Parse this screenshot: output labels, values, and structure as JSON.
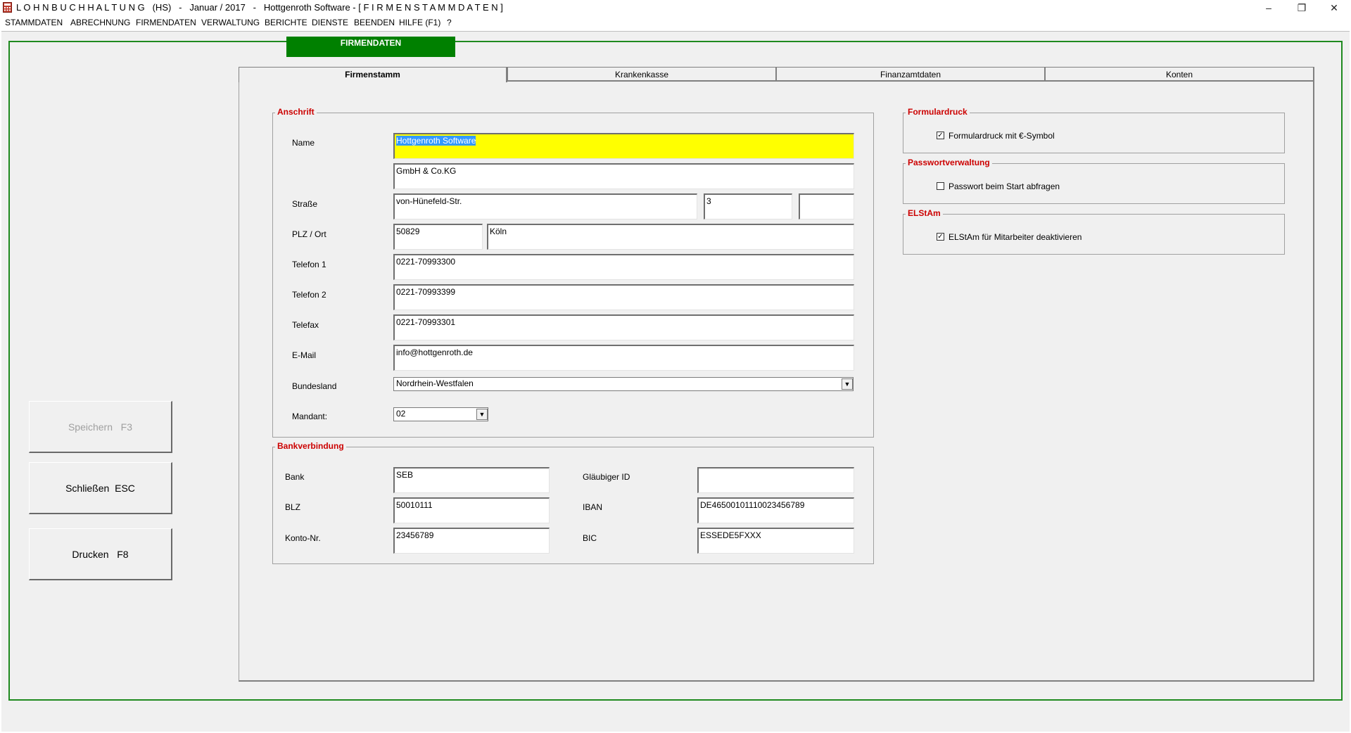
{
  "window": {
    "title": "L O H N B U C H H A L T U N G   (HS)   -   Januar / 2017   -   Hottgenroth Software - [ F I R M E N S T A M M D A T E N ]",
    "minimize": "–",
    "restore": "❐",
    "close": "✕"
  },
  "menu": [
    "STAMMDATEN",
    "ABRECHNUNG",
    "FIRMENDATEN",
    "VERWALTUNG",
    "BERICHTE",
    "DIENSTE",
    "BEENDEN",
    "HILFE (F1)",
    "?"
  ],
  "header": {
    "title": "FIRMENDATEN"
  },
  "buttons": {
    "save": "Speichern   F3",
    "close": "Schließen  ESC",
    "print": "Drucken   F8"
  },
  "tabs": [
    "Firmenstamm",
    "Krankenkasse",
    "Finanzamtdaten",
    "Konten"
  ],
  "anschrift": {
    "title": "Anschrift",
    "labels": {
      "name": "Name",
      "strasse": "Straße",
      "plz_ort": "PLZ / Ort",
      "telefon1": "Telefon 1",
      "telefon2": "Telefon 2",
      "telefax": "Telefax",
      "email": "E-Mail",
      "bundesland": "Bundesland",
      "mandant": "Mandant:"
    },
    "values": {
      "name1": "Hottgenroth Software",
      "name2": "GmbH & Co.KG",
      "strasse": "von-Hünefeld-Str.",
      "hausnr": "3",
      "zusatz": "",
      "plz": "50829",
      "ort": "Köln",
      "telefon1": "0221-70993300",
      "telefon2": "0221-70993399",
      "telefax": "0221-70993301",
      "email": "info@hottgenroth.de",
      "bundesland": "Nordrhein-Westfalen",
      "mandant": "02"
    }
  },
  "bank": {
    "title": "Bankverbindung",
    "labels": {
      "bank": "Bank",
      "blz": "BLZ",
      "konto": "Konto-Nr.",
      "glaeubiger": "Gläubiger ID",
      "iban": "IBAN",
      "bic": "BIC"
    },
    "values": {
      "bank": "SEB",
      "blz": "50010111",
      "konto": "23456789",
      "glaeubiger": "",
      "iban": "DE46500101110023456789",
      "bic": "ESSEDE5FXXX"
    }
  },
  "formulardruck": {
    "title": "Formulardruck",
    "label": "Formulardruck mit €-Symbol",
    "checked": true
  },
  "passwort": {
    "title": "Passwortverwaltung",
    "label": "Passwort beim Start abfragen",
    "checked": false
  },
  "elstam": {
    "title": "ELStAm",
    "label": "ELStAm für Mitarbeiter deaktivieren",
    "checked": true
  },
  "check_mark": "✓"
}
